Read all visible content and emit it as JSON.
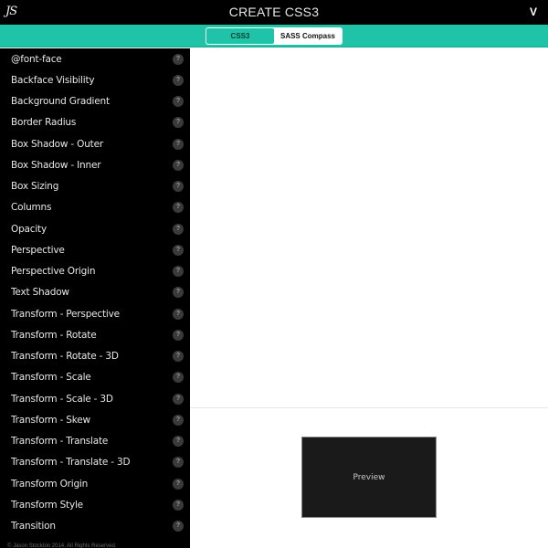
{
  "header": {
    "logo_text": "JS",
    "title": "CREATE CSS3",
    "menu_toggle": "V"
  },
  "tabs": [
    {
      "label": "CSS3",
      "active": true
    },
    {
      "label": "SASS Compass",
      "active": false
    }
  ],
  "sidebar": {
    "items": [
      {
        "label": "@font-face",
        "help": "?"
      },
      {
        "label": "Backface Visibility",
        "help": "?"
      },
      {
        "label": "Background Gradient",
        "help": "?"
      },
      {
        "label": "Border Radius",
        "help": "?"
      },
      {
        "label": "Box Shadow - Outer",
        "help": "?"
      },
      {
        "label": "Box Shadow - Inner",
        "help": "?"
      },
      {
        "label": "Box Sizing",
        "help": "?"
      },
      {
        "label": "Columns",
        "help": "?"
      },
      {
        "label": "Opacity",
        "help": "?"
      },
      {
        "label": "Perspective",
        "help": "?"
      },
      {
        "label": "Perspective Origin",
        "help": "?"
      },
      {
        "label": "Text Shadow",
        "help": "?"
      },
      {
        "label": "Transform - Perspective",
        "help": "?"
      },
      {
        "label": "Transform - Rotate",
        "help": "?"
      },
      {
        "label": "Transform - Rotate - 3D",
        "help": "?"
      },
      {
        "label": "Transform - Scale",
        "help": "?"
      },
      {
        "label": "Transform - Scale - 3D",
        "help": "?"
      },
      {
        "label": "Transform - Skew",
        "help": "?"
      },
      {
        "label": "Transform - Translate",
        "help": "?"
      },
      {
        "label": "Transform - Translate - 3D",
        "help": "?"
      },
      {
        "label": "Transform Origin",
        "help": "?"
      },
      {
        "label": "Transform Style",
        "help": "?"
      },
      {
        "label": "Transition",
        "help": "?"
      }
    ],
    "footer": "© Jason Stockton 2014. All Rights Reserved."
  },
  "preview": {
    "label": "Preview"
  },
  "colors": {
    "accent": "#1fc4a8",
    "header_bg": "#000000",
    "sidebar_bg": "#000000",
    "preview_bg": "#1a1a1a"
  }
}
